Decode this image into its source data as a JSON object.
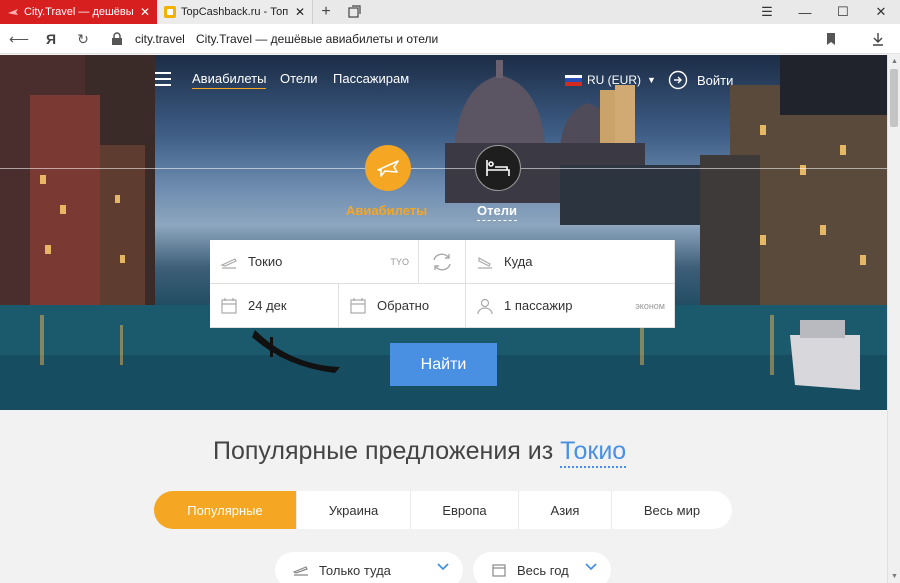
{
  "browser": {
    "tabs": [
      {
        "title": "City.Travel — дешёвые а",
        "active": true,
        "favicon": "plane-icon"
      },
      {
        "title": "TopCashback.ru - Топ лучш",
        "active": false,
        "favicon": "topcashback-icon"
      }
    ],
    "address": {
      "domain": "city.travel",
      "page_title": "City.Travel — дешёвые авиабилеты и отели"
    },
    "yandex_glyph": "Я"
  },
  "header": {
    "nav": [
      {
        "label": "Авиабилеты",
        "active": true
      },
      {
        "label": "Отели",
        "active": false
      },
      {
        "label": "Пассажирам",
        "active": false
      }
    ],
    "language": "RU (EUR)",
    "login": "Войти"
  },
  "modes": {
    "flights": "Авиабилеты",
    "hotels": "Отели"
  },
  "search": {
    "from": {
      "value": "Токио",
      "code": "TYO"
    },
    "to": {
      "placeholder": "Куда"
    },
    "depart": "24 дек",
    "return": "Обратно",
    "passengers": "1 пассажир",
    "class": "эконом",
    "button": "Найти"
  },
  "popular": {
    "title": "Популярные предложения из",
    "city": "Токио",
    "tabs": [
      "Популярные",
      "Украина",
      "Европа",
      "Азия",
      "Весь мир"
    ]
  },
  "filters": {
    "trip_type": "Только туда",
    "period": "Весь год"
  },
  "colors": {
    "accent": "#f5a623",
    "primary": "#4a90e2",
    "tab_active": "#d71f1f"
  }
}
